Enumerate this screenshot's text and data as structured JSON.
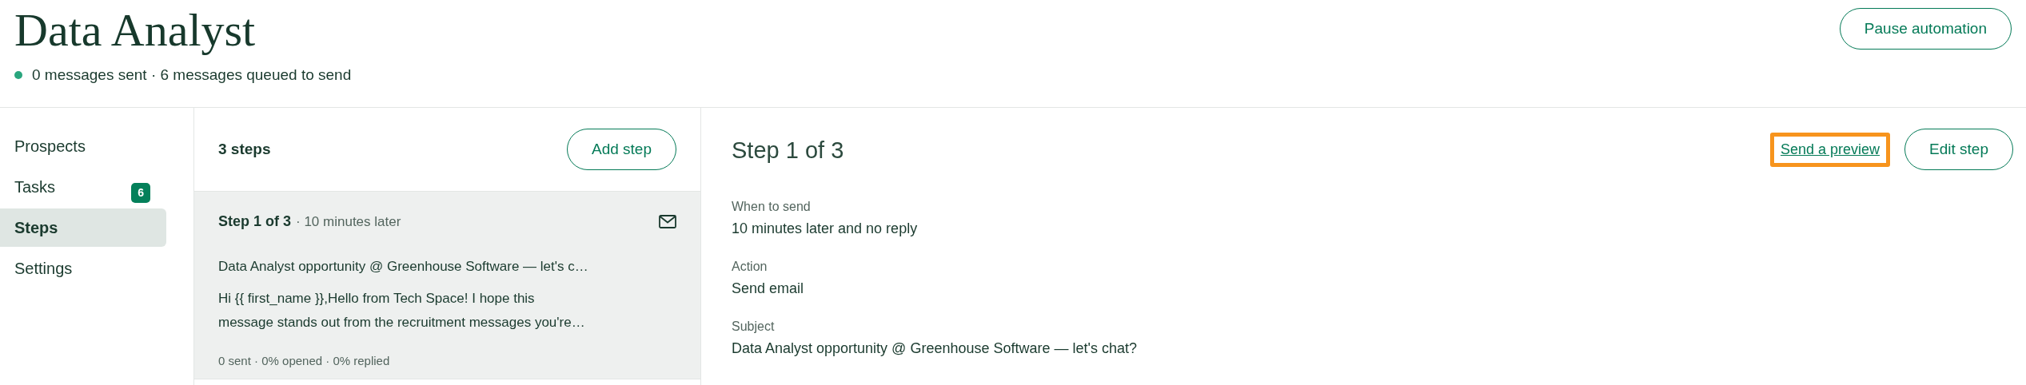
{
  "header": {
    "title": "Data Analyst",
    "status": {
      "color": "#2aa67e",
      "text": "0 messages sent · 6 messages queued to send"
    },
    "button": "Pause automation"
  },
  "sidebar": {
    "items": [
      {
        "label": "Prospects",
        "selected": false
      },
      {
        "label": "Tasks",
        "selected": false,
        "badge": "6"
      },
      {
        "label": "Steps",
        "selected": true
      },
      {
        "label": "Settings",
        "selected": false
      }
    ]
  },
  "steps_list": {
    "title": "3 steps",
    "add_button": "Add step",
    "steps": [
      {
        "title": "Step 1 of 3",
        "timing": "· 10 minutes later",
        "selected": true,
        "subject": "Data Analyst opportunity @ Greenhouse Software — let's c…",
        "body_lines": [
          "Hi {{ first_name }},Hello from Tech Space! I hope this",
          "message stands out from the recruitment messages you're…"
        ],
        "stats": "0 sent · 0% opened · 0% replied"
      }
    ]
  },
  "detail": {
    "title": "Step 1 of 3",
    "preview_link": {
      "label": "Send a preview",
      "highlighted": true
    },
    "edit_button": "Edit step",
    "fields": [
      {
        "label": "When to send",
        "value": "10 minutes later and no reply"
      },
      {
        "label": "Action",
        "value": "Send email"
      },
      {
        "label": "Subject",
        "value": "Data Analyst opportunity @ Greenhouse Software — let's chat?"
      }
    ]
  }
}
